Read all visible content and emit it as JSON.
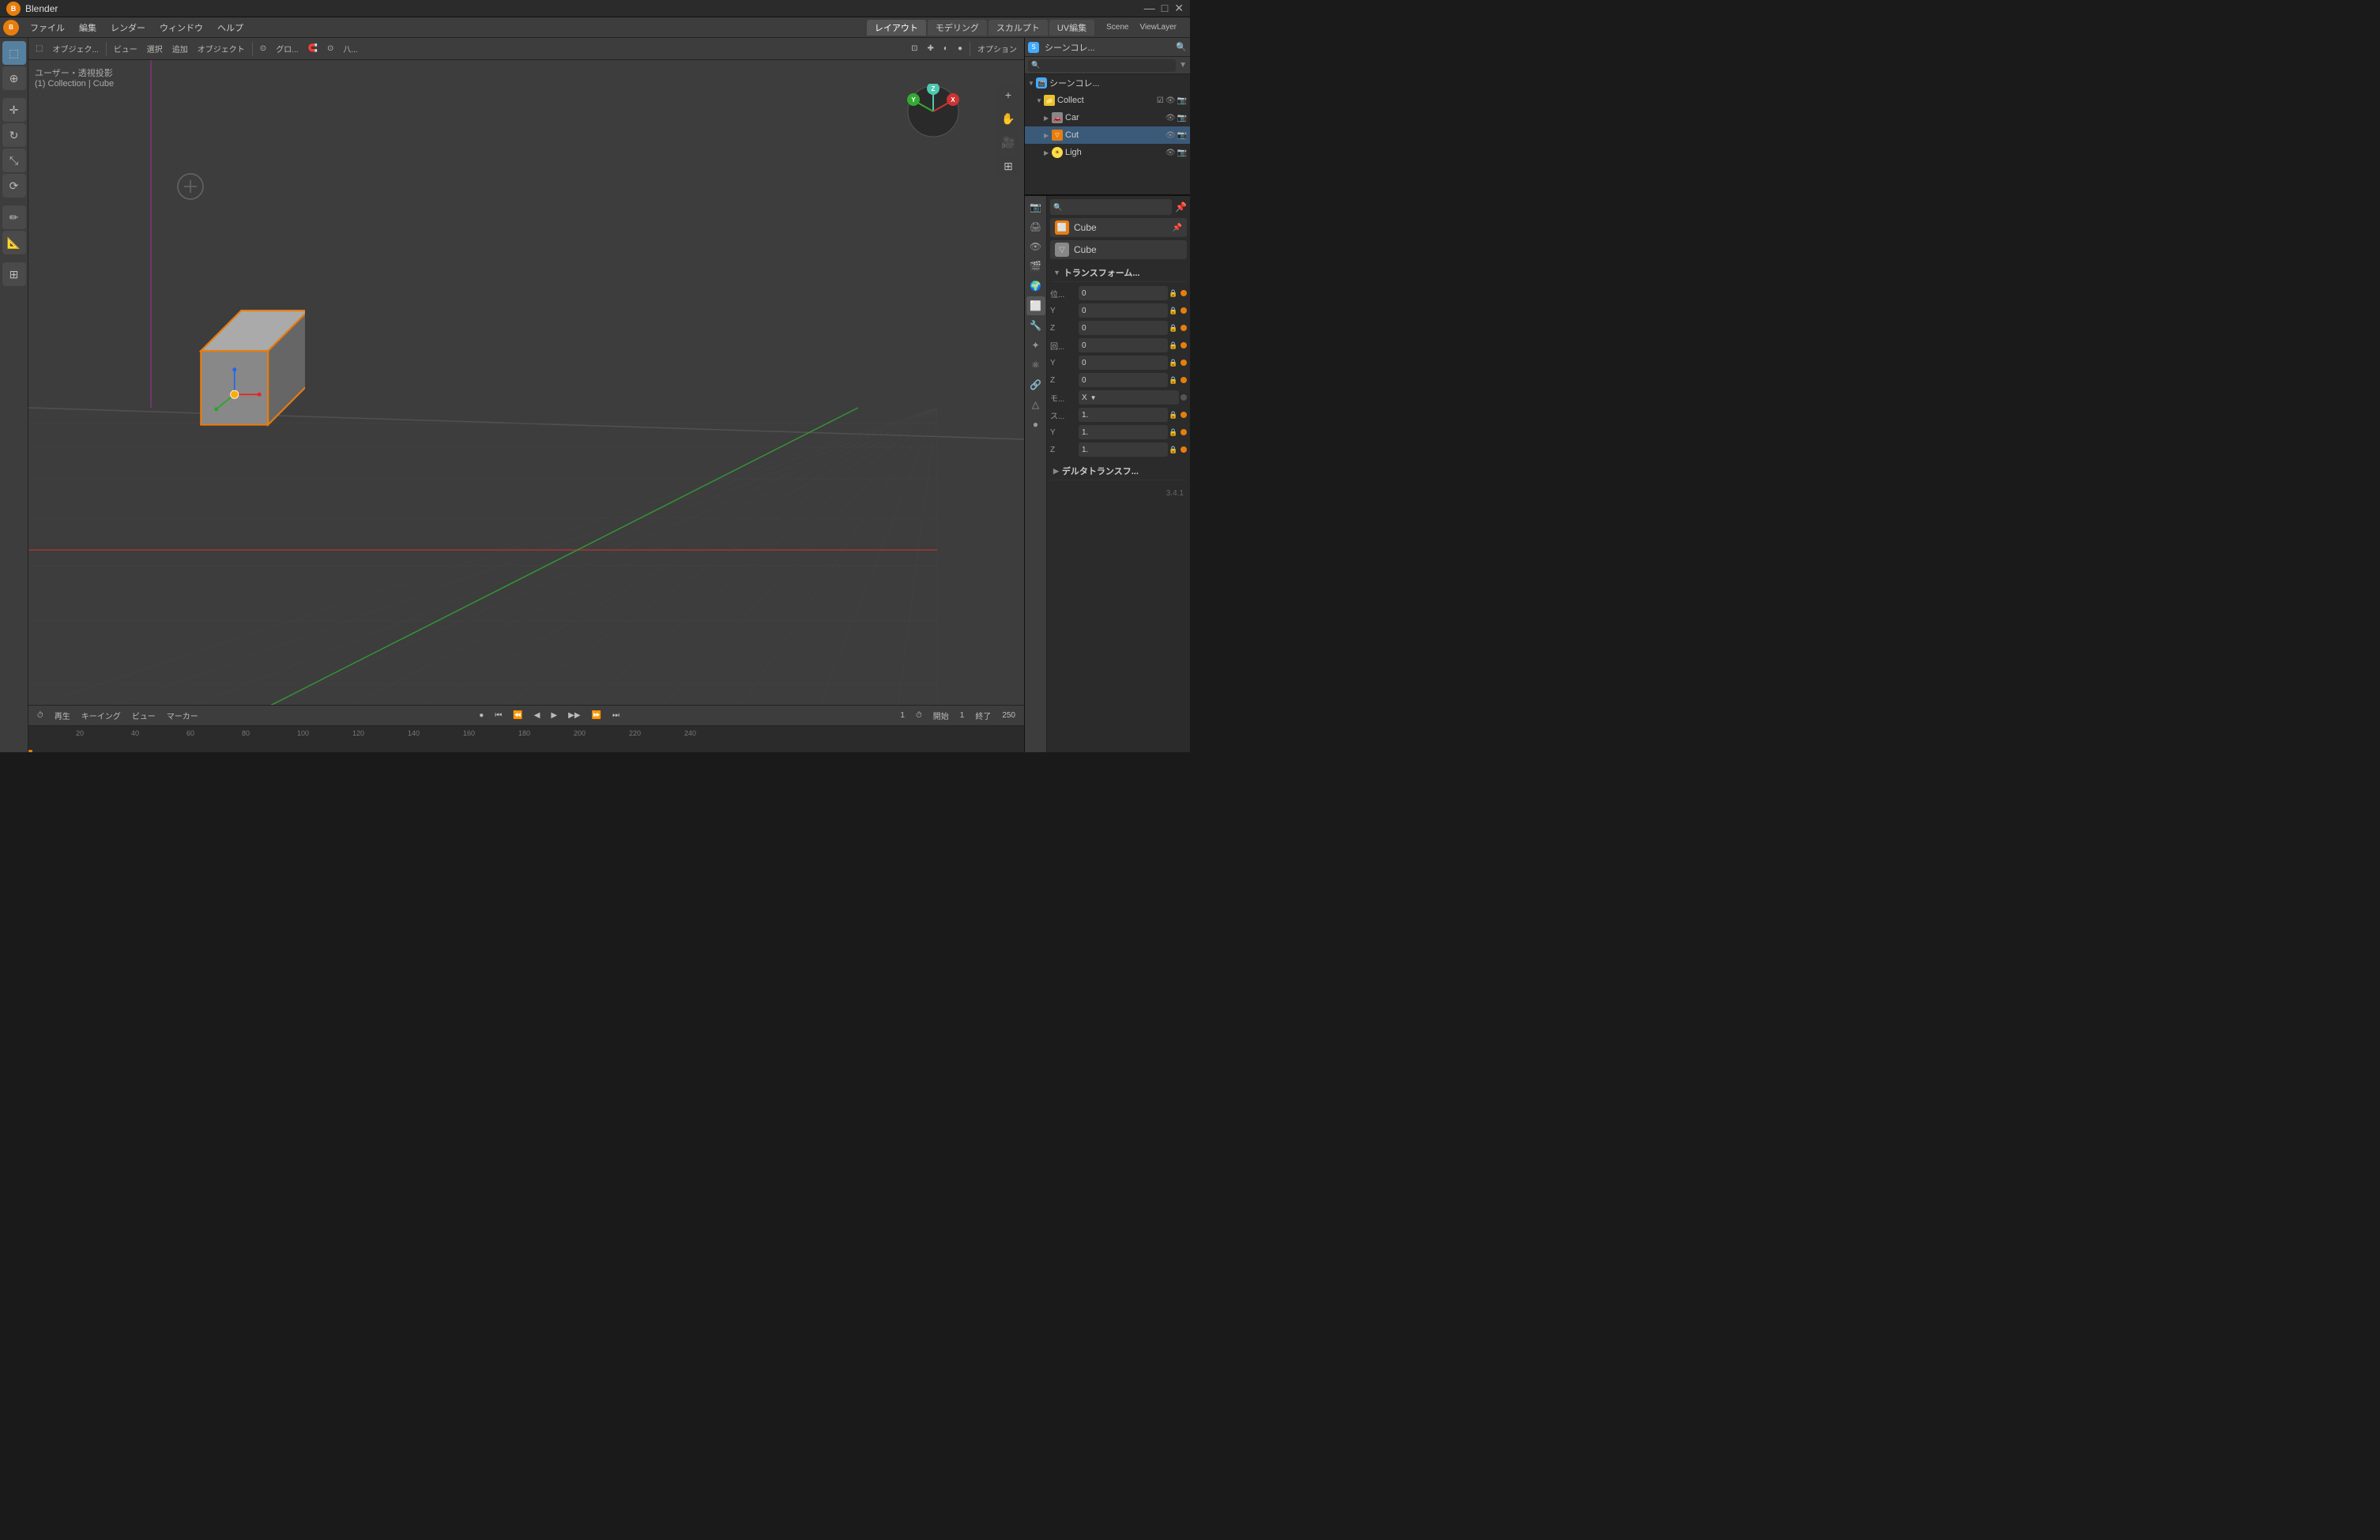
{
  "titlebar": {
    "app_name": "Blender",
    "logo": "B",
    "minimize": "—",
    "maximize": "□",
    "close": "✕"
  },
  "menubar": {
    "logo": "B",
    "items": [
      "ファイル",
      "編集",
      "レンダー",
      "ウィンドウ",
      "ヘルプ"
    ],
    "workspace_tabs": [
      "レイアウト",
      "モデリング",
      "スカルプト",
      "UV編集"
    ],
    "active_workspace": "レイアウト",
    "scene_name": "Scene",
    "view_layer": "ViewLayer"
  },
  "header_toolbar": {
    "mode": "オブジェク...",
    "view": "ビュー",
    "select": "選択",
    "add": "追加",
    "object": "オブジェクト",
    "global": "グロ...",
    "snapping": "八...",
    "options": "オプション"
  },
  "viewport": {
    "info_line1": "ユーザー・透視投影",
    "info_line2": "(1) Collection | Cube",
    "bg_color": "#3d3d3d",
    "grid_color": "#444444"
  },
  "timeline": {
    "play": "再生",
    "keying": "キーイング",
    "view": "ビュー",
    "marker": "マーカー",
    "frame_current": "1",
    "start_label": "開始",
    "start_value": "1",
    "end_label": "終了",
    "end_value": "250",
    "numbers": [
      "20",
      "40",
      "60",
      "80",
      "100",
      "120",
      "140",
      "160",
      "180",
      "200",
      "220",
      "240"
    ]
  },
  "outliner": {
    "header": "シーンコレ...",
    "items": [
      {
        "name": "Collect",
        "type": "collection",
        "indent": 1,
        "expanded": true,
        "visible": true,
        "render": true
      },
      {
        "name": "Car",
        "type": "camera",
        "indent": 2,
        "expanded": false,
        "visible": true,
        "render": true
      },
      {
        "name": "Cut",
        "type": "mesh",
        "indent": 2,
        "expanded": false,
        "visible": true,
        "render": true,
        "selected": true
      },
      {
        "name": "Ligh",
        "type": "light",
        "indent": 2,
        "expanded": false,
        "visible": true,
        "render": true
      }
    ]
  },
  "properties": {
    "active_tab": "object",
    "object_name": "Cube",
    "data_name": "Cube",
    "transform_label": "トランスフォーム...",
    "location": {
      "label": "位...",
      "x": "0",
      "y": "0",
      "z": "0"
    },
    "rotation": {
      "label": "回...",
      "x": "0",
      "y": "0",
      "z": "0"
    },
    "mode_label": "モ...",
    "mode_value": "X",
    "scale_label": "ス...",
    "scale": {
      "x": "1.",
      "y": "1.",
      "z": "1."
    },
    "delta_transform_label": "デルタトランスフ...",
    "tabs": [
      "render",
      "output",
      "view",
      "scene",
      "world",
      "object",
      "modifier",
      "particles",
      "physics",
      "constraints",
      "object_data",
      "material",
      "shader"
    ],
    "version": "3.4.1"
  },
  "icons": {
    "blender": "⬤",
    "select": "⬚",
    "cursor": "⊕",
    "move": "✛",
    "rotate": "↻",
    "scale": "⤡",
    "transform": "⟳",
    "annotate": "✏",
    "measure": "📏",
    "add_cube": "⊞",
    "zoom_in": "+",
    "zoom_out": "-",
    "hand": "✋",
    "camera_view": "🎥",
    "grid": "⊞",
    "eye": "👁",
    "camera": "📷",
    "pin": "📌",
    "search": "🔍",
    "lock": "🔒",
    "wrench": "🔧",
    "render_props": "📷",
    "tool_wrench": "⚙",
    "scene_prop": "🎬",
    "obj_prop": "⬜",
    "mod_prop": "🔵",
    "vert_prop": "△"
  }
}
